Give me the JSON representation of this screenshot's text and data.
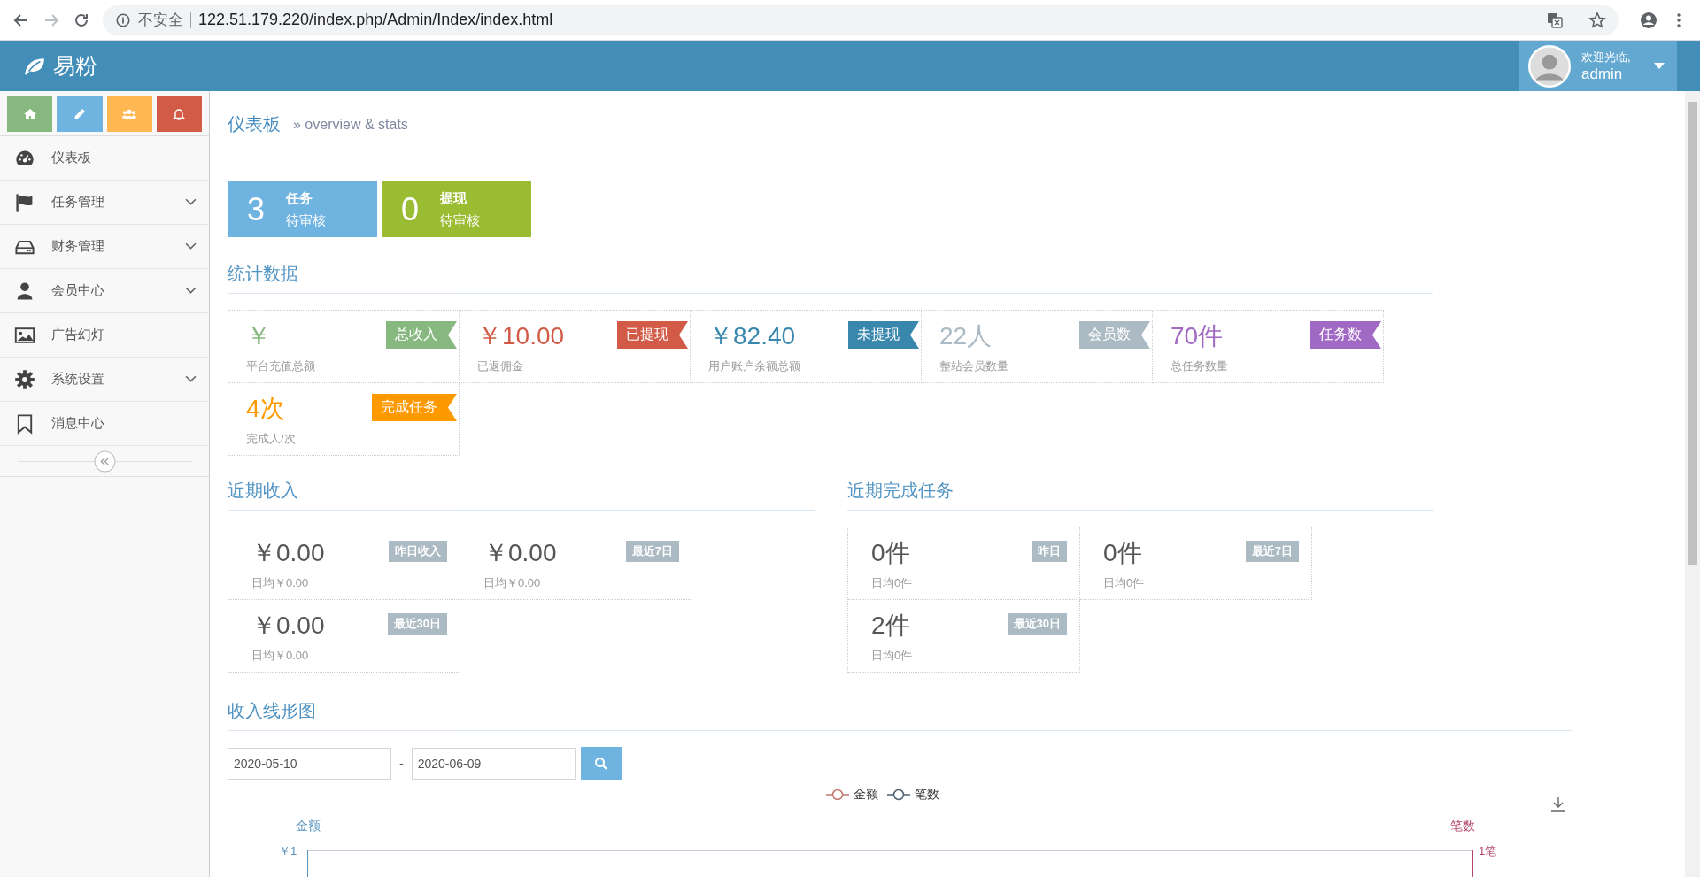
{
  "browser": {
    "security": "不安全",
    "url": "122.51.179.220/index.php/Admin/Index/index.html"
  },
  "header": {
    "brand": "易粉",
    "greeting": "欢迎光临,",
    "user": "admin"
  },
  "shortcuts": [
    {
      "kind": "home",
      "color": "#87b87f"
    },
    {
      "kind": "pencil",
      "color": "#6fb3e0"
    },
    {
      "kind": "users",
      "color": "#ffb752"
    },
    {
      "kind": "bell",
      "color": "#d15b47"
    }
  ],
  "sidebar": {
    "items": [
      {
        "label": "仪表板",
        "kind": "dashboard",
        "submenu": false
      },
      {
        "label": "任务管理",
        "kind": "flag",
        "submenu": true
      },
      {
        "label": "财务管理",
        "kind": "drive",
        "submenu": true
      },
      {
        "label": "会员中心",
        "kind": "user",
        "submenu": true
      },
      {
        "label": "广告幻灯",
        "kind": "picture",
        "submenu": false
      },
      {
        "label": "系统设置",
        "kind": "gear",
        "submenu": true
      },
      {
        "label": "消息中心",
        "kind": "bookmark",
        "submenu": false
      }
    ]
  },
  "breadcrumb": {
    "title": "仪表板",
    "subtitle": "» overview & stats"
  },
  "pending": [
    {
      "count": "3",
      "title": "任务",
      "status": "待审核",
      "color": "#6fb3e0"
    },
    {
      "count": "0",
      "title": "提现",
      "status": "待审核",
      "color": "#9abc32"
    }
  ],
  "stats": {
    "heading": "统计数据",
    "items": [
      {
        "value": "￥",
        "caption": "平台充值总额",
        "tag": "总收入",
        "color": "#87b87f"
      },
      {
        "value": "￥10.00",
        "caption": "已返佣金",
        "tag": "已提现",
        "color": "#d15b47"
      },
      {
        "value": "￥82.40",
        "caption": "用户账户余额总额",
        "tag": "未提现",
        "color": "#3a87ad"
      },
      {
        "value": "22人",
        "caption": "整站会员数量",
        "tag": "会员数",
        "color": "#abbac3"
      },
      {
        "value": "70件",
        "caption": "总任务数量",
        "tag": "任务数",
        "color": "#a069c3"
      },
      {
        "value": "4次",
        "caption": "完成人/次",
        "tag": "完成任务",
        "color": "#ff9900"
      }
    ]
  },
  "recent_income": {
    "heading": "近期收入",
    "items": [
      {
        "value": "￥0.00",
        "tag": "昨日收入",
        "average": "日均￥0.00"
      },
      {
        "value": "￥0.00",
        "tag": "最近7日",
        "average": "日均￥0.00"
      },
      {
        "value": "￥0.00",
        "tag": "最近30日",
        "average": "日均￥0.00"
      }
    ]
  },
  "recent_tasks": {
    "heading": "近期完成任务",
    "items": [
      {
        "value": "0件",
        "tag": "昨日",
        "average": "日均0件"
      },
      {
        "value": "0件",
        "tag": "最近7日",
        "average": "日均0件"
      },
      {
        "value": "2件",
        "tag": "最近30日",
        "average": "日均0件"
      }
    ]
  },
  "chart": {
    "title": "收入线形图",
    "start_date": "2020-05-10",
    "separator": "-",
    "end_date": "2020-06-09",
    "legend": [
      {
        "label": "金额",
        "color": "#c2776f"
      },
      {
        "label": "笔数",
        "color": "#4f5f6f"
      }
    ],
    "left_axis": {
      "name": "金额",
      "tick": "￥1",
      "color": "#5793c2"
    },
    "right_axis": {
      "name": "笔数",
      "tick": "1笔",
      "color": "#b5466a"
    }
  }
}
